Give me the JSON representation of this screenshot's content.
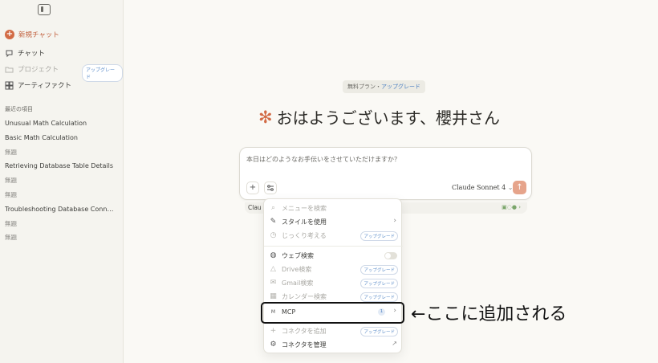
{
  "sidebar": {
    "new_chat": "新規チャット",
    "nav": {
      "chat": "チャット",
      "projects": "プロジェクト",
      "projects_badge": "アップグレード",
      "artifacts": "アーティファクト"
    },
    "recent_header": "最近の項目",
    "recent": [
      "Unusual Math Calculation",
      "Basic Math Calculation",
      "無題",
      "Retrieving Database Table Details",
      "無題",
      "無題",
      "Troubleshooting Database Connec...",
      "無題",
      "無題"
    ]
  },
  "main": {
    "plan": {
      "free": "無料プラン",
      "sep": "・",
      "upgrade": "アップグレード"
    },
    "greeting": "おはようございます、櫻井さん",
    "input_placeholder": "本日はどのようなお手伝いをさせていただけますか？",
    "model": "Claude Sonnet 4",
    "model_chevron": "⌄",
    "under_text": "Clau"
  },
  "menu": {
    "search": "メニューを検索",
    "style": "スタイルを使用",
    "think": "じっくり考える",
    "think_badge": "アップグレード",
    "web_search": "ウェブ検索",
    "drive": "Drive検索",
    "drive_badge": "アップグレード",
    "gmail": "Gmail検索",
    "gmail_badge": "アップグレード",
    "calendar": "カレンダー検索",
    "calendar_badge": "アップグレード",
    "mcp": "MCP",
    "mcp_count": "1",
    "add_connector": "コネクタを追加",
    "add_connector_badge": "アップグレード",
    "manage_connectors": "コネクタを管理"
  },
  "annotation": "←ここに追加される",
  "colors": {
    "accent": "#d26b45",
    "link": "#4a7fc1",
    "background": "#faf9f5"
  }
}
